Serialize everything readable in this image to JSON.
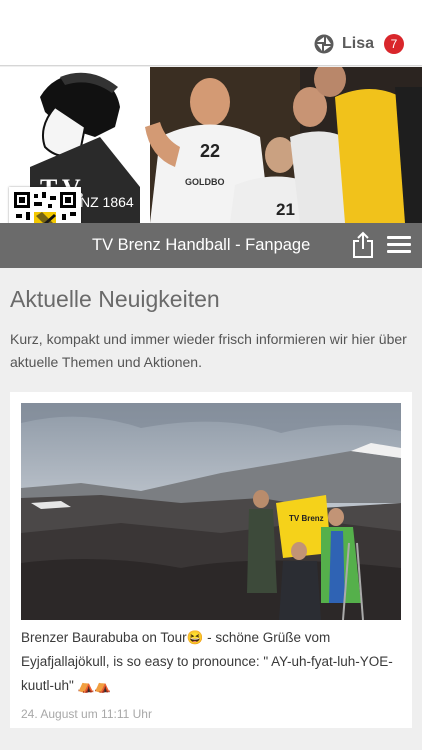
{
  "user": {
    "icon": "logo-swirl-icon",
    "name": "Lisa",
    "badge_count": "7"
  },
  "header": {
    "page_title": "TV Brenz Handball - Fanpage",
    "logo_text": "T.V.",
    "logo_year": "NZ 1864",
    "jersey_numbers": [
      "22",
      "21"
    ],
    "jersey_sponsor": "GOLDBO",
    "share_icon": "share-icon",
    "menu_icon": "hamburger-menu-icon"
  },
  "section": {
    "title": "Aktuelle Neuigkeiten",
    "description": "Kurz, kompakt und immer wieder frisch informieren wir hier über aktuelle Themen und Aktionen."
  },
  "post": {
    "text": "Brenzer Baurabuba on Tour😆 - schöne Grüße vom Eyjafjallajökull, is so easy to pronounce: \" AY-uh-fyat-luh-YOE-kuutl-uh\" ⛺⛺",
    "date": "24. August um 11:11 Uhr",
    "photo_shirt_text": "TV Brenz"
  },
  "colors": {
    "titlebar": "#6b6b6b",
    "badge": "#d9262b",
    "background": "#efefef"
  }
}
